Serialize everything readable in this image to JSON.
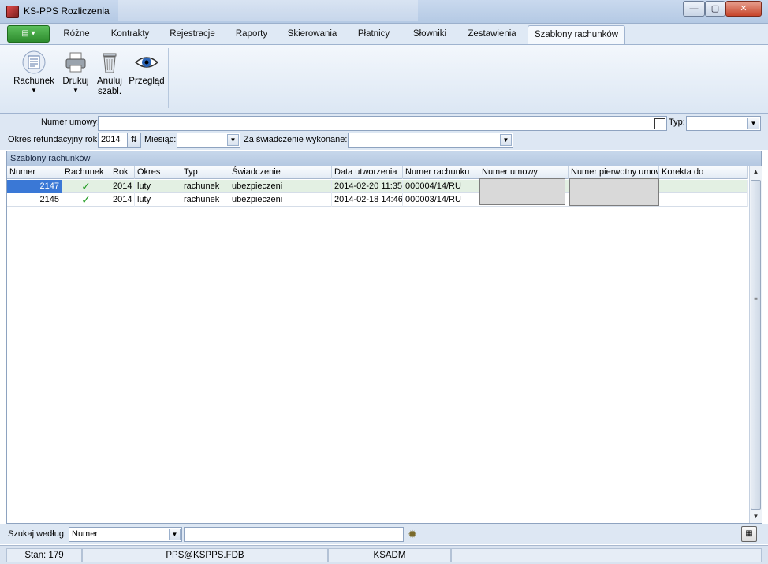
{
  "window": {
    "title": "KS-PPS Rozliczenia",
    "minimize": "—",
    "maximize": "▢",
    "close": "✕"
  },
  "ribbon": {
    "app_menu_icon": "menu-icon",
    "app_menu_glyph": "▤ ▾",
    "tabs": [
      "Różne",
      "Kontrakty",
      "Rejestracje",
      "Raporty",
      "Skierowania",
      "Płatnicy",
      "Słowniki",
      "Zestawienia",
      "Szablony rachunków"
    ],
    "active_tab": "Szablony rachunków",
    "buttons": [
      {
        "label": "Rachunek",
        "icon": "document-icon",
        "has_dropdown": true
      },
      {
        "label": "Drukuj",
        "icon": "printer-icon",
        "has_dropdown": true
      },
      {
        "label": "Anuluj szabl.",
        "icon": "trash-icon",
        "has_dropdown": false
      },
      {
        "label": "Przegląd",
        "icon": "eye-icon",
        "has_dropdown": false
      }
    ]
  },
  "filters": {
    "numer_umowy_label": "Numer umowy:",
    "numer_umowy_value": "",
    "typ_label": "Typ:",
    "typ_value": "",
    "okres_label": "Okres refundacyjny rok:",
    "okres_value": "2014",
    "miesiac_label": "Miesiąc:",
    "miesiac_value": "",
    "za_swiadczenie_label": "Za świadczenie wykonane:",
    "za_swiadczenie_value": ""
  },
  "grid": {
    "caption": "Szablony rachunków",
    "columns": [
      "Numer",
      "Rachunek",
      "Rok",
      "Okres",
      "Typ",
      "Świadczenie",
      "Data utworzenia",
      "Numer rachunku",
      "Numer umowy",
      "Numer pierwotny umow",
      "Korekta do"
    ],
    "rows": [
      {
        "numer": "2147",
        "rachunek": "✓",
        "rok": "2014",
        "okres": "luty",
        "typ": "rachunek",
        "swiadczenie": "ubezpieczeni",
        "data": "2014-02-20 11:35",
        "numer_rachunku": "000004/14/RU",
        "numer_umowy": "",
        "numer_pierwotny": "",
        "korekta": "",
        "selected": true
      },
      {
        "numer": "2145",
        "rachunek": "✓",
        "rok": "2014",
        "okres": "luty",
        "typ": "rachunek",
        "swiadczenie": "ubezpieczeni",
        "data": "2014-02-18 14:46",
        "numer_rachunku": "000003/14/RU",
        "numer_umowy": "",
        "numer_pierwotny": "",
        "korekta": "",
        "selected": false
      }
    ]
  },
  "search": {
    "label": "Szukaj według:",
    "field_value": "Numer",
    "query_value": ""
  },
  "status": {
    "stan": "Stan: 179",
    "database": "PPS@KSPPS.FDB",
    "user": "KSADM",
    "extra": ""
  }
}
